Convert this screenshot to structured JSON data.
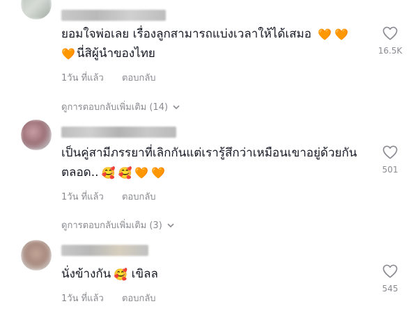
{
  "colors": {
    "accent_heart": "#f46a16",
    "muted": "#8a8b91",
    "text": "#161823"
  },
  "comments": [
    {
      "text_line1": "ยอมใจพ่อเลย เรื่องลูกสามารถแบ่งเวลาให้ได้เสมอ",
      "text_line2": "นี่สิผู้นำของไทย",
      "time": "1วัน ที่แล้ว",
      "reply": "ตอบกลับ",
      "view_replies": "ดูการตอบกลับเพิ่มเติม (14)",
      "likes": "16.5K",
      "emojis_line1": [
        "orange-heart",
        "orange-heart"
      ],
      "emojis_line2": [
        "orange-heart"
      ]
    },
    {
      "text_line1": "เป็นคู่สามีภรรยาที่เลิกกันแต่เรารู้สึกว่าเหมือนเขาอยู่ด้วยกัน",
      "text_line2": "ตลอด..",
      "time": "1วัน ที่แล้ว",
      "reply": "ตอบกลับ",
      "view_replies": "ดูการตอบกลับเพิ่มเติม (3)",
      "likes": "501",
      "emojis_line2": [
        "smiling-face-with-hearts",
        "smiling-face-with-hearts",
        "orange-heart",
        "orange-heart"
      ]
    },
    {
      "text_line1": "นั่งข้างกัน",
      "text_line1_after": "เขิลล",
      "time": "1วัน ที่แล้ว",
      "reply": "ตอบกลับ",
      "likes": "545",
      "emojis_line1": [
        "smiling-face-with-hearts"
      ]
    }
  ]
}
